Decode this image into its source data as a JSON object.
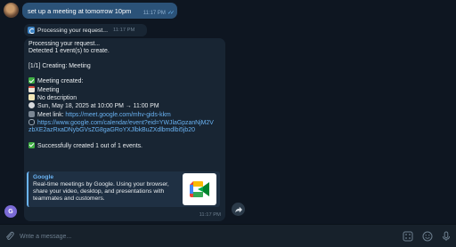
{
  "outgoing": {
    "text": "set up a meeting at tomorrow 10pm",
    "time": "11:17 PM"
  },
  "status_message": {
    "text": "Processing your request...",
    "time": "11:17 PM"
  },
  "response": {
    "line1": "Processing your request...",
    "line2": "Detected 1 event(s) to create.",
    "line3": "[1/1] Creating: Meeting",
    "created_label": "Meeting created:",
    "title": "Meeting",
    "description": "No description",
    "datetime": "Sun, May 18, 2025 at 10:00 PM → 11:00 PM",
    "meet_prefix": "Meet link:",
    "meet_url": "https://meet.google.com/mhv-gids-kkm",
    "calendar_url": "https://www.google.com/calendar/event?eid=YWJlaGpzanNjM2VzbXE2azRxaDNybGVsZG8gaGRoYXJlbkBuZXdlbmdlbi5jb20",
    "summary": "Successfully created 1 out of 1 events.",
    "time": "11:17 PM"
  },
  "preview": {
    "site": "Google",
    "description": "Real-time meetings by Google. Using your browser, share your video, desktop, and presentations with teammates and customers."
  },
  "bot_avatar_letter": "G",
  "composer": {
    "placeholder": "Write a message..."
  },
  "colors": {
    "background": "#0e1621",
    "outgoing_bubble": "#2b5278",
    "incoming_bubble": "#182533",
    "link": "#6ab3f3"
  }
}
